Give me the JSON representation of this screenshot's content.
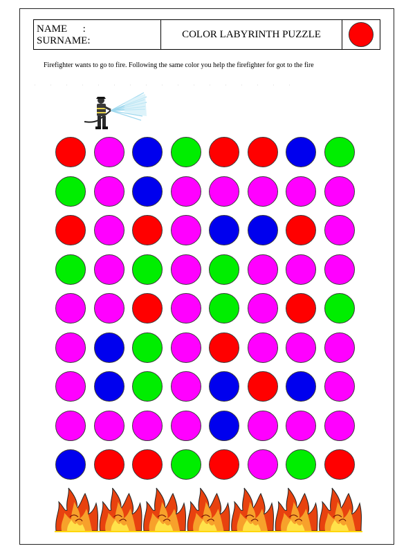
{
  "header": {
    "name_label": "NAME      :",
    "surname_label": "SURNAME:",
    "title": "COLOR LABYRINTH PUZZLE",
    "target_color": "#ff0000"
  },
  "instruction": "Firefighter wants to go to fire. Following the same color you help the firefighter for got to the fire",
  "palette": {
    "R": "#ff0000",
    "M": "#ff00ff",
    "B": "#0000ee",
    "G": "#00ee00"
  },
  "grid": [
    [
      "R",
      "M",
      "B",
      "G",
      "R",
      "R",
      "B",
      "G"
    ],
    [
      "G",
      "M",
      "B",
      "M",
      "M",
      "M",
      "M",
      "M"
    ],
    [
      "R",
      "M",
      "R",
      "M",
      "B",
      "B",
      "R",
      "M"
    ],
    [
      "G",
      "M",
      "G",
      "M",
      "G",
      "M",
      "M",
      "M"
    ],
    [
      "M",
      "M",
      "R",
      "M",
      "G",
      "M",
      "R",
      "G"
    ],
    [
      "M",
      "B",
      "G",
      "M",
      "R",
      "M",
      "M",
      "M"
    ],
    [
      "M",
      "B",
      "G",
      "M",
      "B",
      "R",
      "B",
      "M"
    ],
    [
      "M",
      "M",
      "M",
      "M",
      "B",
      "M",
      "M",
      "M"
    ],
    [
      "B",
      "R",
      "R",
      "G",
      "R",
      "M",
      "G",
      "R"
    ]
  ],
  "icons": {
    "hero": "firefighter-icon",
    "goal": "fire-icon"
  },
  "fire_count": 7
}
